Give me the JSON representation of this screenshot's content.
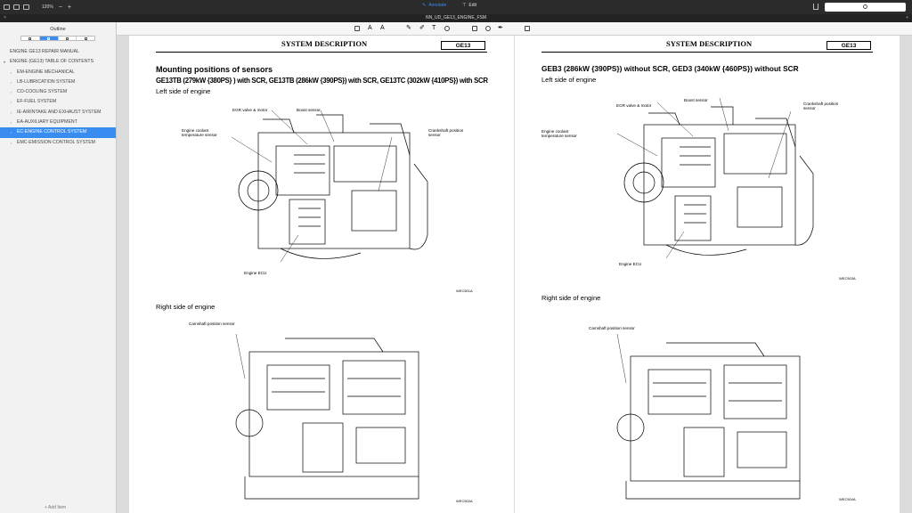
{
  "toolbar": {
    "zoom": "120%",
    "zoom_out": "−",
    "zoom_in": "+",
    "annotate_label": "Annotate",
    "edit_label": "Edit"
  },
  "tab": {
    "title": "NN_UD_GE13_ENGINE_FSM",
    "close": "×",
    "new": "+"
  },
  "sidebar": {
    "title": "Outline",
    "add_label": "+ Add Item",
    "items": [
      {
        "label": "ENGINE GE13 REPAIR MANUAL",
        "level": "top",
        "arrow": ""
      },
      {
        "label": "ENGINE (GE13) TABLE OF CONTENTS",
        "level": "top",
        "arrow": "▾"
      },
      {
        "label": "EM-ENGINE MECHANICAL",
        "level": "child",
        "arrow": "›"
      },
      {
        "label": "LB-LUBRICATION SYSTEM",
        "level": "child",
        "arrow": "›"
      },
      {
        "label": "CO-COOLING SYSTEM",
        "level": "child",
        "arrow": "›"
      },
      {
        "label": "EF-FUEL SYSTEM",
        "level": "child",
        "arrow": "›"
      },
      {
        "label": "IE-AIRINTAKE AND EXHAUST SYSTEM",
        "level": "child",
        "arrow": "›"
      },
      {
        "label": "EA-AUXILIARY EQUIPMENT",
        "level": "child",
        "arrow": "›"
      },
      {
        "label": "EC-ENGINE CONTROL SYSTEM",
        "level": "child",
        "arrow": "›",
        "selected": true
      },
      {
        "label": "EMC-EMISSION CONTROL SYSTEM",
        "level": "child",
        "arrow": "›"
      }
    ]
  },
  "page1": {
    "header": "SYSTEM DESCRIPTION",
    "badge": "GE13",
    "heading": "Mounting positions of sensors",
    "subheading": "GE13TB (279kW {380PS} ) with SCR, GE13TB (286kW {390PS}) with SCR, GE13TC (302kW {410PS}) with SCR",
    "left_side": "Left side of engine",
    "right_side": "Right side of engine",
    "labels": {
      "egr": "EGR valve & motor",
      "boost": "Boost sensor",
      "coolant": "Engine coolant\ntemperature sensor",
      "crank": "Crankshaft position\nsensor",
      "ecu": "Engine ECU",
      "cam": "Camshaft position sensor"
    },
    "code1": "WEC501A",
    "code2": "WEC502A"
  },
  "page2": {
    "header": "SYSTEM DESCRIPTION",
    "badge": "GE13",
    "heading": "GEB3 (286kW {390PS}) without SCR, GED3 (340kW {460PS}) without SCR",
    "left_side": "Left side of engine",
    "right_side": "Right side of engine",
    "labels": {
      "egr": "EGR valve & motor",
      "boost": "Boost sensor",
      "coolant": "Engine coolant\ntemperature sensor",
      "crank": "Crankshaft position\nsensor",
      "ecu": "Engine ECU",
      "cam": "Camshaft position sensor"
    },
    "code1": "WEC503A",
    "code2": "WEC504A"
  }
}
